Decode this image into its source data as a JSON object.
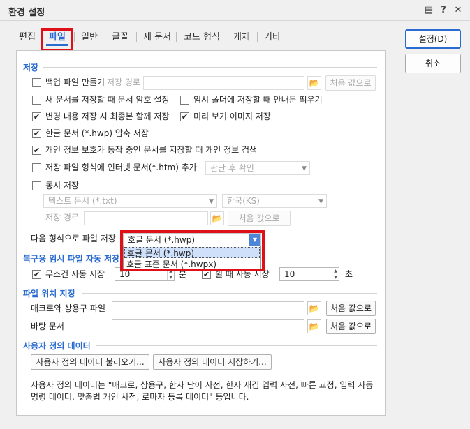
{
  "window": {
    "title": "환경 설정",
    "icons": [
      "menu-icon",
      "help-icon",
      "close-icon"
    ],
    "help_glyph": "?",
    "close_glyph": "✕",
    "menu_glyph": "▤"
  },
  "tabs": [
    "편집",
    "파일",
    "일반",
    "글꼴",
    "새 문서",
    "코드 형식",
    "개체",
    "기타"
  ],
  "active_tab": "파일",
  "side_buttons": {
    "ok": "설정(D)",
    "cancel": "취소"
  },
  "save_section": {
    "title": "저장",
    "backup": {
      "label": "백업 파일 만들기",
      "checked": false,
      "path_label": "저장 경로",
      "reset": "처음 값으로"
    },
    "new_doc_password": {
      "label": "새 문서를 저장할 때 문서 암호 설정",
      "checked": false
    },
    "temp_folder_notice": {
      "label": "임시 폴더에 저장할 때 안내문 띄우기",
      "checked": false
    },
    "save_latest": {
      "label": "변경 내용 저장 시 최종본 함께 저장",
      "checked": true
    },
    "preview_image": {
      "label": "미리 보기 이미지 저장",
      "checked": true
    },
    "compress_hwp": {
      "label": "한글 문서 (*.hwp) 압축 저장",
      "checked": true
    },
    "privacy_search": {
      "label": "개인 정보 보호가 동작 중인 문서를 저장할 때 개인 정보 검색",
      "checked": true
    },
    "add_internet_format": {
      "label": "저장 파일 형식에 인터넷 문서(*.htm) 추가",
      "checked": false,
      "select": "판단 후 확인"
    },
    "simultaneous": {
      "label": "동시 저장",
      "checked": false,
      "format": "텍스트 문서 (*.txt)",
      "encoding": "한국(KS)",
      "path_label": "저장 경로",
      "reset": "처음 값으로"
    },
    "next_format": {
      "label": "다음 형식으로 파일 저장",
      "value": "호글 문서 (*.hwp)",
      "options": [
        "호글 문서 (*.hwp)",
        "호글 표준 문서 (*.hwpx)"
      ]
    }
  },
  "recovery_section": {
    "title": "복구용 임시 파일 자동 저장",
    "unconditional": {
      "label": "무조건 자동 저장",
      "checked": true,
      "value": "10",
      "unit": "분"
    },
    "idle": {
      "label": "쉴 때 자동 저장",
      "checked": true,
      "value": "10",
      "unit": "초"
    }
  },
  "location_section": {
    "title": "파일 위치 지정",
    "macro": {
      "label": "매크로와 상용구 파일",
      "reset": "처음 값으로"
    },
    "desktop": {
      "label": "바탕 문서",
      "reset": "처음 값으로"
    }
  },
  "userdata_section": {
    "title": "사용자 정의 데이터",
    "load": "사용자 정의 데이터 불러오기...",
    "save": "사용자 정의 데이터 저장하기...",
    "desc_line1": "사용자 정의 데이터는 \"매크로, 상용구, 한자 단어 사전, 한자 새김 입력 사전, 빠른 교정, 입력 자동",
    "desc_line2": "명령 데이터, 맞춤법 개인 사전, 로마자 등록 데이터\" 등입니다."
  },
  "colors": {
    "accent": "#2a6bd1",
    "highlight": "#e01018"
  }
}
